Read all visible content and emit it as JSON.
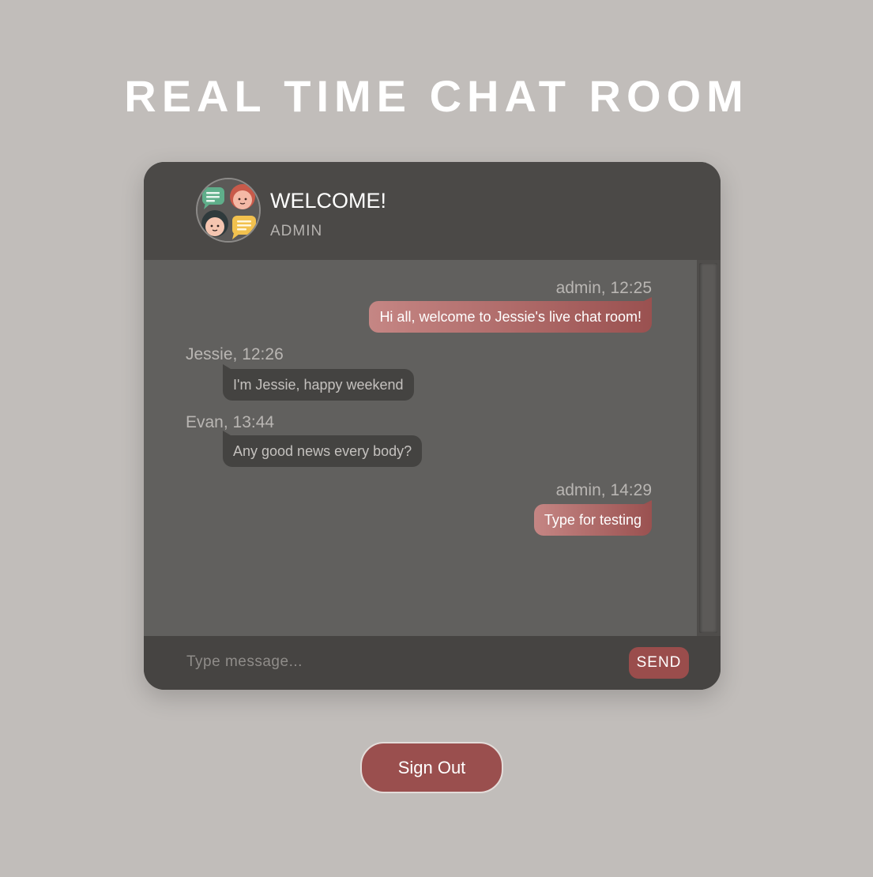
{
  "page": {
    "title": "REAL TIME CHAT ROOM"
  },
  "header": {
    "avatar_icon": "chat-people-avatar-icon",
    "welcome": "WELCOME!",
    "username": "ADMIN"
  },
  "messages": [
    {
      "sender": "admin",
      "meta": "admin, 12:25",
      "text": "Hi all, welcome to Jessie's live chat room!",
      "own": true
    },
    {
      "sender": "Jessie",
      "meta": "Jessie, 12:26",
      "text": "I'm Jessie, happy weekend",
      "own": false
    },
    {
      "sender": "Evan",
      "meta": "Evan, 13:44",
      "text": "Any good news every body?",
      "own": false
    },
    {
      "sender": "admin",
      "meta": "admin, 14:29",
      "text": "Type for testing",
      "own": true
    }
  ],
  "composer": {
    "placeholder": "Type message...",
    "value": "",
    "send_label": "SEND"
  },
  "footer": {
    "signout_label": "Sign Out"
  },
  "colors": {
    "background": "#c1bdba",
    "accent": "#9a4d4c",
    "header": "#4b4947",
    "messages_area": "#61605e"
  }
}
